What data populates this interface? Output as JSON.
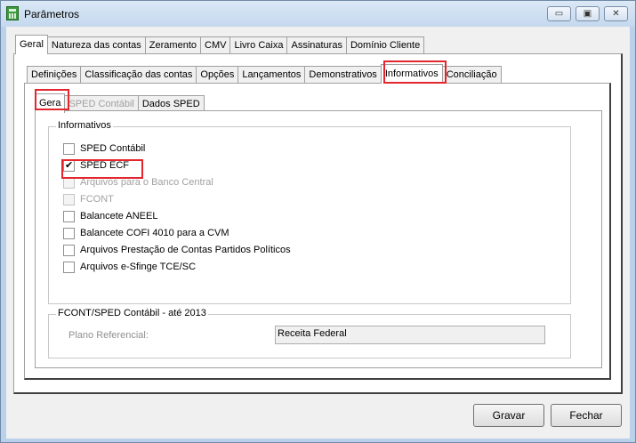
{
  "window": {
    "title": "Parâmetros",
    "controls": {
      "minimize": "▭",
      "restore": "▣",
      "close": "✕"
    }
  },
  "main_tabs": [
    "Geral",
    "Natureza das contas",
    "Zeramento",
    "CMV",
    "Livro Caixa",
    "Assinaturas",
    "Domínio Cliente"
  ],
  "sub_tabs": [
    "Definições",
    "Classificação das contas",
    "Opções",
    "Lançamentos",
    "Demonstrativos",
    "Informativos",
    "Conciliação"
  ],
  "inner_tabs": [
    "Gera",
    "SPED Contábil",
    "Dados SPED"
  ],
  "informativos": {
    "title": "Informativos",
    "items": [
      {
        "label": "SPED Contábil",
        "checked": false,
        "enabled": true
      },
      {
        "label": "SPED ECF",
        "checked": true,
        "enabled": true
      },
      {
        "label": "Arquivos para o Banco Central",
        "checked": false,
        "enabled": false
      },
      {
        "label": "FCONT",
        "checked": false,
        "enabled": false
      },
      {
        "label": "Balancete ANEEL",
        "checked": false,
        "enabled": true
      },
      {
        "label": "Balancete COFI 4010 para a CVM",
        "checked": false,
        "enabled": true
      },
      {
        "label": "Arquivos Prestação de Contas Partidos Políticos",
        "checked": false,
        "enabled": true
      },
      {
        "label": "Arquivos e-Sfinge TCE/SC",
        "checked": false,
        "enabled": true
      }
    ]
  },
  "fcont": {
    "title": "FCONT/SPED Contábil - até 2013",
    "plano_label": "Plano Referencial:",
    "plano_value": "Receita Federal"
  },
  "buttons": {
    "gravar": "Gravar",
    "fechar": "Fechar"
  },
  "colors": {
    "highlight": "#e3262e",
    "titlebar": "#c4d8ee"
  }
}
